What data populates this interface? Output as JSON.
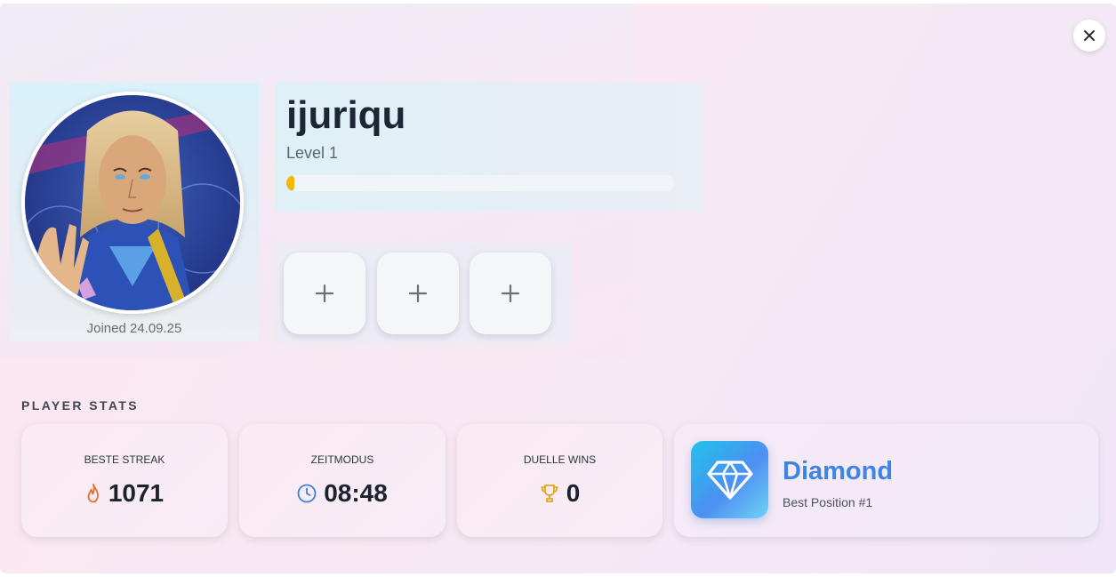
{
  "profile": {
    "username": "ijuriqu",
    "level_label": "Level 1",
    "level_progress_percent": 2,
    "joined_label": "Joined 24.09.25",
    "avatar_icon": "avatar-portrait"
  },
  "slots": [
    {
      "label": "+"
    },
    {
      "label": "+"
    },
    {
      "label": "+"
    }
  ],
  "stats_section": {
    "title": "PLAYER STATS"
  },
  "stats": [
    {
      "label": "BESTE STREAK",
      "value": "1071",
      "icon": "flame-icon"
    },
    {
      "label": "ZEITMODUS",
      "value": "08:48",
      "icon": "clock-icon"
    },
    {
      "label": "DUELLE WINS",
      "value": "0",
      "icon": "trophy-icon"
    }
  ],
  "rank": {
    "name": "Diamond",
    "position_label": "Best Position #1",
    "icon": "diamond-icon"
  },
  "colors": {
    "accent_blue": "#3e84e5",
    "progress_yellow": "#f2b807",
    "flame_orange": "#e2732f",
    "clock_blue": "#3f7de0",
    "trophy_gold": "#e2a619"
  }
}
